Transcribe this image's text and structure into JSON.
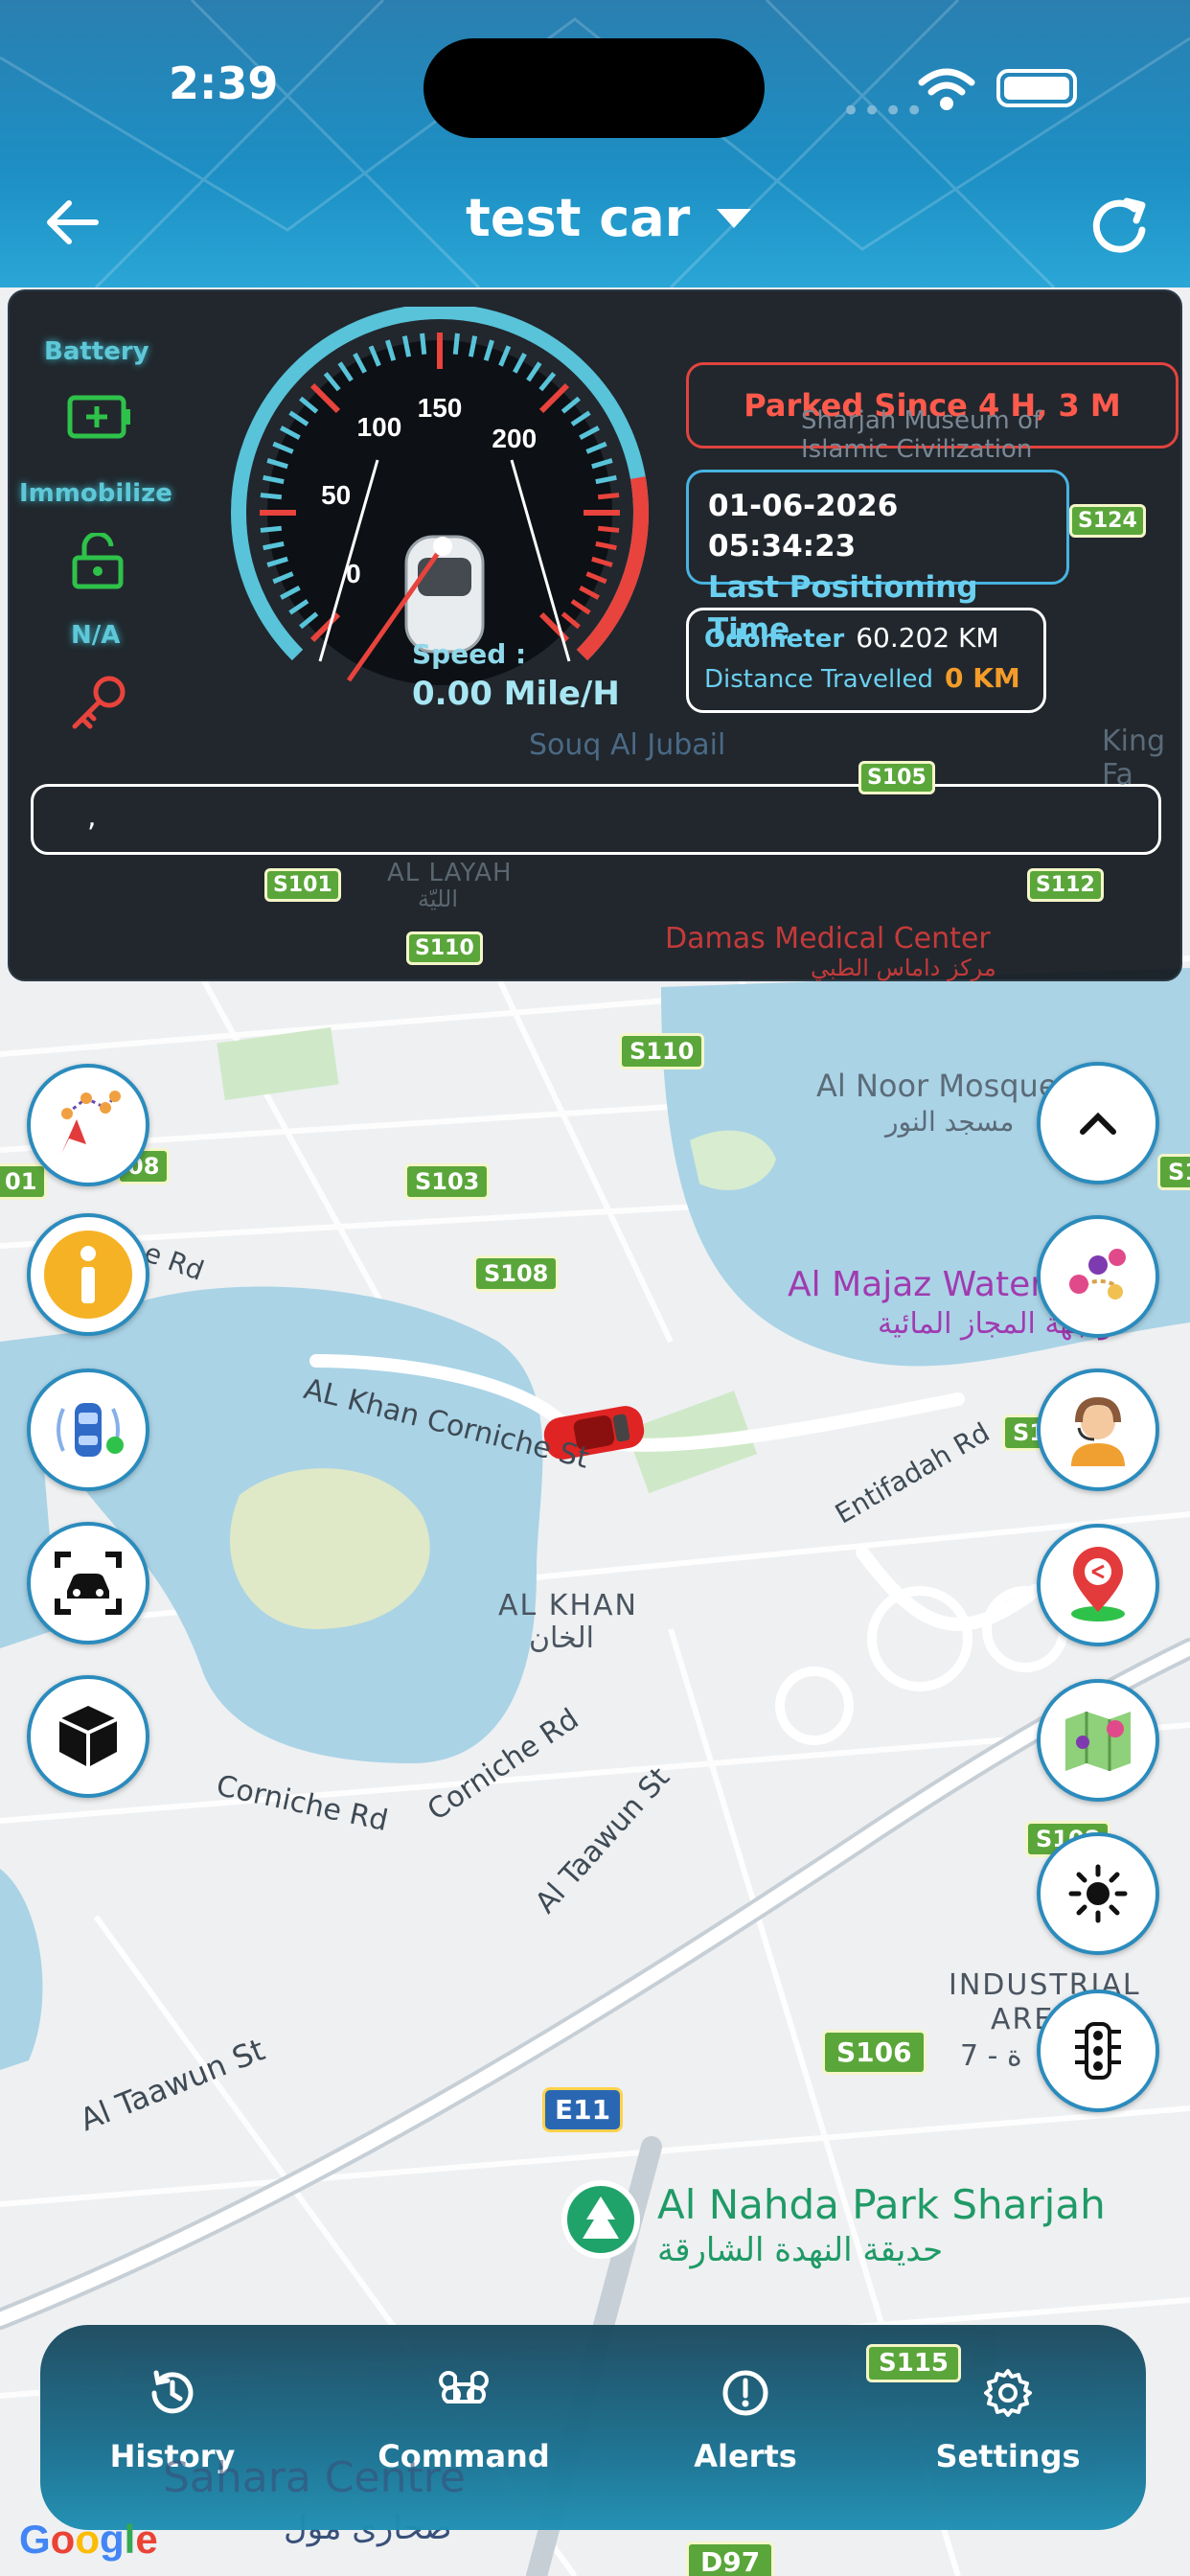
{
  "status_bar": {
    "time": "2:39",
    "dots": "••••"
  },
  "header": {
    "title": "test car"
  },
  "dashboard": {
    "battery_label": "Battery",
    "immobilize_label": "Immobilize",
    "na_label": "N/A",
    "gauge_ticks": [
      "0",
      "50",
      "100",
      "150",
      "200"
    ],
    "speed_label": "Speed :",
    "speed_value": "0.00 Mile/H",
    "parked": "Parked Since 4 H, 3 M",
    "position_time": "01-06-2026 05:34:23",
    "position_time_label": "Last Positioning Time",
    "odometer_label": "Odometer",
    "odometer_value": "60.202 KM",
    "distance_label": "Distance Travelled",
    "distance_value": "0 KM",
    "address": ","
  },
  "map_labels": {
    "museum": "Sharjah Museum of Islamic Civilization",
    "souq": "Souq Al Jubail",
    "king": "King Fa",
    "al_layah": "AL LAYAH",
    "al_layah_ar": "الليّة",
    "damas": "Damas Medical Center",
    "damas_ar": "مركز داماس الطبي",
    "al_noor": "Al Noor Mosque",
    "al_noor_ar": "مسجد النور",
    "majaz": "Al Majaz Waterfr",
    "majaz_ar": "واجهة المجاز المائية",
    "khan_corniche": "AL Khan Corniche St",
    "khan_rd": "e Rd",
    "entifadah": "Entifadah Rd",
    "al_khan": "AL KHAN",
    "al_khan_ar": "الخان",
    "corniche_rd_1": "Corniche Rd",
    "corniche_rd_2": "Corniche Rd",
    "taawun_st": "Al Taawun St",
    "taawun_st_2": "Al Taawun St",
    "industrial": "INDUSTRIAL",
    "industrial_2": "ARE",
    "industrial_3": "7 - ة",
    "nahda": "Al Nahda Park Sharjah",
    "nahda_ar": "حديقة النهدة الشارقة",
    "sahara": "Sahara Centre",
    "sahara_ar": "صحارى مول",
    "google": "Google"
  },
  "road_badges": {
    "s110_top": "S110",
    "s101": "S101",
    "s105": "S105",
    "s112": "S112",
    "s124": "S124",
    "s110": "S110",
    "s103": "S103",
    "s108": "S108",
    "s08": "08",
    "s01": "01",
    "s1_right": "S1",
    "s11": "S11",
    "s108b": "S108",
    "s106": "S106",
    "e11": "E11",
    "s115": "S115",
    "d97": "D97"
  },
  "bottom_nav": {
    "history": "History",
    "command": "Command",
    "alerts": "Alerts",
    "settings": "Settings"
  },
  "colors": {
    "header": "#1d8fc4",
    "panel": "#141a20",
    "accent_cyan": "#5ec8d8",
    "parked_red": "#e0443e",
    "distance_orange": "#f39c2a",
    "water": "#a8d8ea",
    "park_green": "#cfe9c8"
  }
}
